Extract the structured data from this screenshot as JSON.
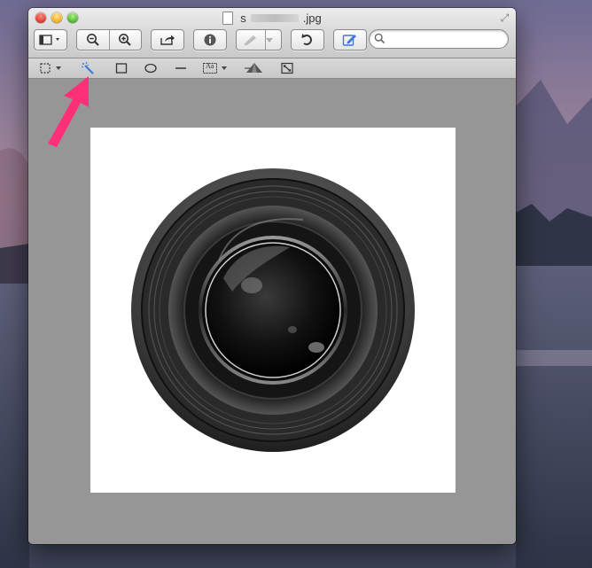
{
  "window": {
    "title_prefix": "s",
    "title_suffix": ".jpg",
    "fullscreen_glyph": "⤢"
  },
  "toolbar": {
    "sidebar_button_icon": "sidebar-view-icon",
    "zoom_out_icon": "zoom-out-icon",
    "zoom_in_icon": "zoom-in-icon",
    "share_icon": "share-icon",
    "info_icon": "info-icon",
    "rotate_icon": "rotate-icon",
    "markup_icon": "pencil-icon",
    "search": {
      "value": "",
      "placeholder": ""
    }
  },
  "markup_tools": [
    {
      "name": "rectangular-selection",
      "icon": "dashed-rect-icon",
      "has_menu": true
    },
    {
      "name": "instant-alpha",
      "icon": "magic-wand-icon",
      "selected": true
    },
    {
      "name": "rectangle",
      "icon": "rectangle-icon"
    },
    {
      "name": "oval",
      "icon": "oval-icon"
    },
    {
      "name": "line",
      "icon": "line-icon"
    },
    {
      "name": "text",
      "icon": "text-box-icon",
      "label": "Aa",
      "has_menu": true
    },
    {
      "name": "adjust-color",
      "icon": "prism-icon"
    },
    {
      "name": "adjust-size",
      "icon": "resize-icon"
    }
  ],
  "document": {
    "image_subject": "camera-lens-icon"
  },
  "annotation": {
    "arrow_color": "#ff2f7a"
  },
  "colors": {
    "accent": "#3d7bd9",
    "canvas_bg": "#969696",
    "arrow": "#ff2f7a"
  }
}
